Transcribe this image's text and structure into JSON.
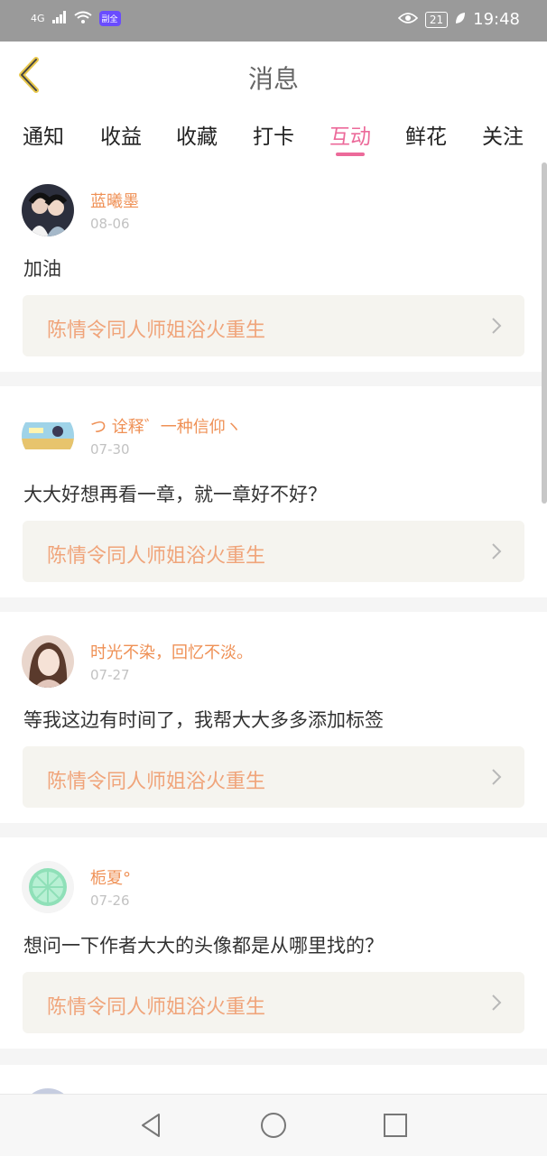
{
  "status_bar": {
    "network": "4G",
    "badge": "副全",
    "battery": "21",
    "time": "19:48"
  },
  "header": {
    "title": "消息"
  },
  "tabs": [
    {
      "label": "通知"
    },
    {
      "label": "收益"
    },
    {
      "label": "收藏"
    },
    {
      "label": "打卡"
    },
    {
      "label": "互动"
    },
    {
      "label": "鲜花"
    },
    {
      "label": "关注"
    }
  ],
  "active_tab": "互动",
  "colors": {
    "accent": "#ec6a9a",
    "name": "#ef9055",
    "ref_text": "#f0a47a",
    "ref_bg": "#f5f4ef"
  },
  "messages": [
    {
      "name": "蓝曦墨",
      "date": "08-06",
      "text": "加油",
      "ref": "陈情令同人师姐浴火重生",
      "avatar": "anime-portrait"
    },
    {
      "name": "つ 诠释゛一种信仰ヽ",
      "date": "07-30",
      "text": "大大好想再看一章，就一章好不好？",
      "ref": "陈情令同人师姐浴火重生",
      "avatar": "anime-landscape"
    },
    {
      "name": "时光不染，回忆不淡。",
      "date": "07-27",
      "text": "等我这边有时间了，我帮大大多多添加标签",
      "ref": "陈情令同人师姐浴火重生",
      "avatar": "girl-portrait"
    },
    {
      "name": "栀夏°",
      "date": "07-26",
      "text": "想问一下作者大大的头像都是从哪里找的？",
      "ref": "陈情令同人师姐浴火重生",
      "avatar": "lime-slice"
    }
  ]
}
